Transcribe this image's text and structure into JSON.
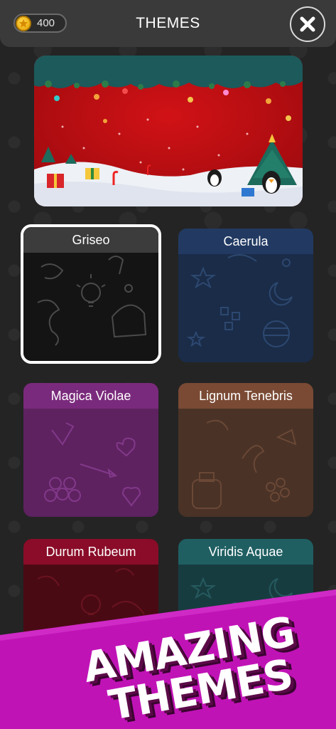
{
  "header": {
    "coins": "400",
    "title": "THEMES"
  },
  "themes": [
    {
      "name": "Griseo",
      "header_color": "#3c3c3c",
      "body_color": "#141414",
      "selected": true
    },
    {
      "name": "Caerula",
      "header_color": "#223a62",
      "body_color": "#1a2c48",
      "selected": false
    },
    {
      "name": "Magica Violae",
      "header_color": "#7a2a7c",
      "body_color": "#5e2260",
      "selected": false
    },
    {
      "name": "Lignum Tenebris",
      "header_color": "#7a4a34",
      "body_color": "#4a3226",
      "selected": false
    },
    {
      "name": "Durum Rubeum",
      "header_color": "#8a0c28",
      "body_color": "#4a0a14",
      "selected": false
    },
    {
      "name": "Viridis Aquae",
      "header_color": "#1f5f62",
      "body_color": "#173c40",
      "selected": false
    }
  ],
  "banner": {
    "line1": "AMAZING",
    "line2": "THEMES",
    "color": "#c013b6"
  },
  "icons": [
    "coin-icon",
    "close-icon"
  ]
}
